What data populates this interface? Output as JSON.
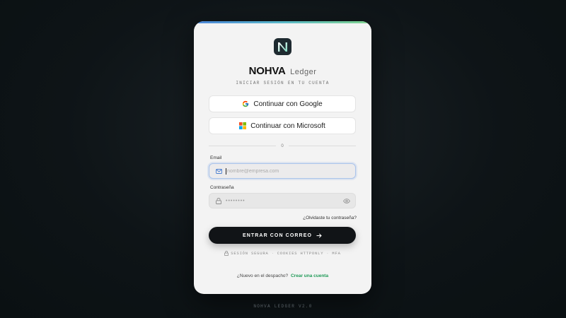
{
  "brand": {
    "logo_icon": "nohva-logo-icon",
    "name": "NOHVA",
    "product": "Ledger",
    "subtitle": "INICIAR SESIÓN EN TU CUENTA"
  },
  "sso": {
    "google_label": "Continuar con Google",
    "google_icon": "google-icon",
    "microsoft_label": "Continuar con Microsoft",
    "microsoft_icon": "microsoft-icon"
  },
  "divider_text": "O",
  "form": {
    "email_label": "Email",
    "email_placeholder": "nombre@empresa.com",
    "email_icon": "mail-icon",
    "password_label": "Contraseña",
    "password_placeholder": "••••••••",
    "password_icon": "lock-icon",
    "show_password_icon": "eye-icon",
    "forgot_link": "¿Olvidaste tu contraseña?",
    "submit_label": "ENTRAR CON CORREO",
    "submit_icon": "arrow-right-icon"
  },
  "security_badges": [
    "SESIÓN SEGURA",
    "COOKIES HTTPONLY",
    "MFA"
  ],
  "signup": {
    "prompt": "¿Nuevo en el despacho?",
    "link": "Crear una cuenta"
  },
  "version": "NOHVA LEDGER V2.0",
  "colors": {
    "accent_green": "#1f9a57",
    "button_dark": "#111417",
    "focus_blue": "#a9c3ea",
    "top_gradient": [
      "#4a84d8",
      "#59b8c8",
      "#7fd28c"
    ]
  }
}
